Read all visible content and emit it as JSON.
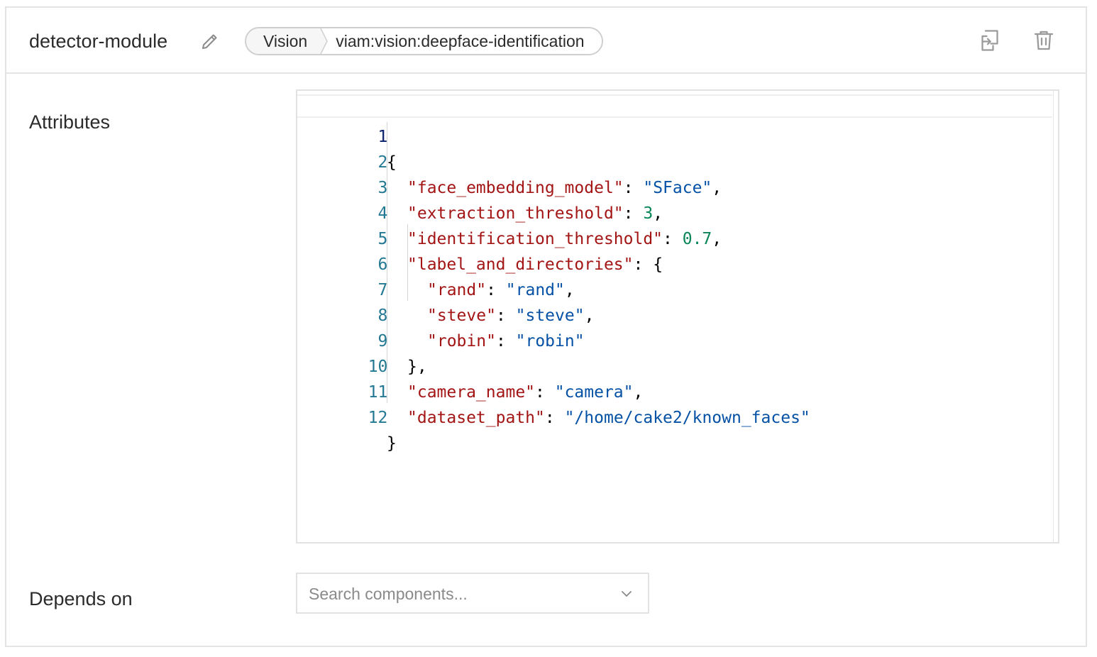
{
  "header": {
    "title": "detector-module",
    "breadcrumb": {
      "type": "Vision",
      "model": "viam:vision:deepface-identification"
    }
  },
  "sections": {
    "attributes_label": "Attributes",
    "depends_on_label": "Depends on"
  },
  "editor": {
    "line_numbers": [
      "1",
      "2",
      "3",
      "4",
      "5",
      "6",
      "7",
      "8",
      "9",
      "10",
      "11",
      "12"
    ],
    "lines": {
      "l1": "{",
      "l2": {
        "key": "\"face_embedding_model\"",
        "sep": ": ",
        "val": "\"SFace\"",
        "end": ","
      },
      "l3": {
        "key": "\"extraction_threshold\"",
        "sep": ": ",
        "val": "3",
        "end": ","
      },
      "l4": {
        "key": "\"identification_threshold\"",
        "sep": ": ",
        "val": "0.7",
        "end": ","
      },
      "l5": {
        "key": "\"label_and_directories\"",
        "sep": ": ",
        "end": "{"
      },
      "l6": {
        "key": "\"rand\"",
        "sep": ": ",
        "val": "\"rand\"",
        "end": ","
      },
      "l7": {
        "key": "\"steve\"",
        "sep": ": ",
        "val": "\"steve\"",
        "end": ","
      },
      "l8": {
        "key": "\"robin\"",
        "sep": ": ",
        "val": "\"robin\"",
        "end": ""
      },
      "l9": "},",
      "l10": {
        "key": "\"camera_name\"",
        "sep": ": ",
        "val": "\"camera\"",
        "end": ","
      },
      "l11": {
        "key": "\"dataset_path\"",
        "sep": ": ",
        "val": "\"/home/cake2/known_faces\"",
        "end": ""
      },
      "l12": "}"
    }
  },
  "depends_on": {
    "placeholder": "Search components..."
  },
  "icons": {
    "edit": "pencil-icon",
    "duplicate": "duplicate-icon",
    "delete": "trash-icon",
    "dropdown": "chevron-down-icon"
  },
  "colors": {
    "json_key": "#a31515",
    "json_string": "#0451a5",
    "json_number": "#098658",
    "line_number": "#237893"
  }
}
